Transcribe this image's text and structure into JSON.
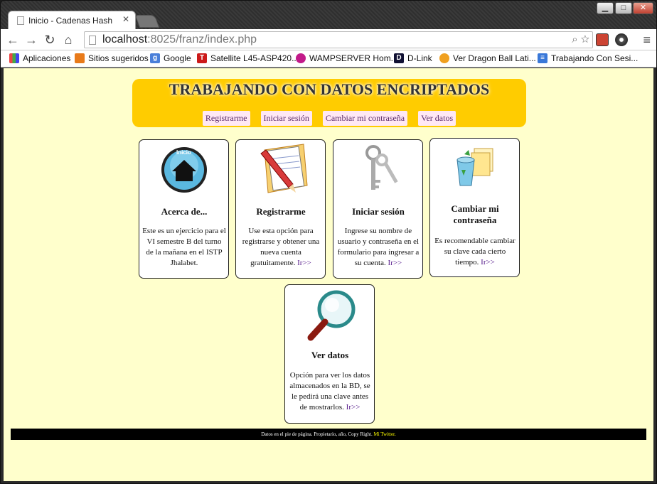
{
  "browser": {
    "tab_title": "Inicio - Cadenas Hash",
    "url_host": "localhost",
    "url_path": ":8025/franz/index.php",
    "bookmarks": [
      "Aplicaciones",
      "Sitios sugeridos",
      "Google",
      "Satellite L45-ASP420...",
      "WAMPSERVER Hom...",
      "D-Link",
      "Ver Dragon Ball Lati...",
      "Trabajando Con Sesi..."
    ]
  },
  "header": {
    "title": "TRABAJANDO CON DATOS ENCRIPTADOS",
    "nav": [
      "Registrarme",
      "Iniciar sesión",
      "Cambiar mi contraseña",
      "Ver datos"
    ]
  },
  "cards": [
    {
      "title": "Acerca de...",
      "text": "Este es un ejercicio para el VI semestre B del turno de la mañana en el ISTP Jhalabet.",
      "link": ""
    },
    {
      "title": "Registrarme",
      "text": "Use esta opción para registrarse y obtener una nueva cuenta gratuitamente.",
      "link": "Ir>>"
    },
    {
      "title": "Iniciar sesión",
      "text": "Ingrese su nombre de usuario y contraseña en el formulario para ingresar a su cuenta.",
      "link": "Ir>>"
    },
    {
      "title": "Cambiar mi contraseña",
      "text": "Es recomendable cambiar su clave cada cierto tiempo.",
      "link": "Ir>>"
    },
    {
      "title": "Ver datos",
      "text": "Opción para ver los datos almacenados en la BD, se le pedirá una clave antes de mostrarlos.",
      "link": "Ir>>"
    }
  ],
  "icon_labels": {
    "home": "Inicio"
  },
  "footer": {
    "text": "Datos en el pie de página. Propietario, año, Copy Right.",
    "link": "Mi Twitter."
  },
  "colors": {
    "page_bg": "#ffffcc",
    "header_bg": "#ffcc00",
    "footer_bg": "#000000",
    "link": "#551a8b"
  }
}
